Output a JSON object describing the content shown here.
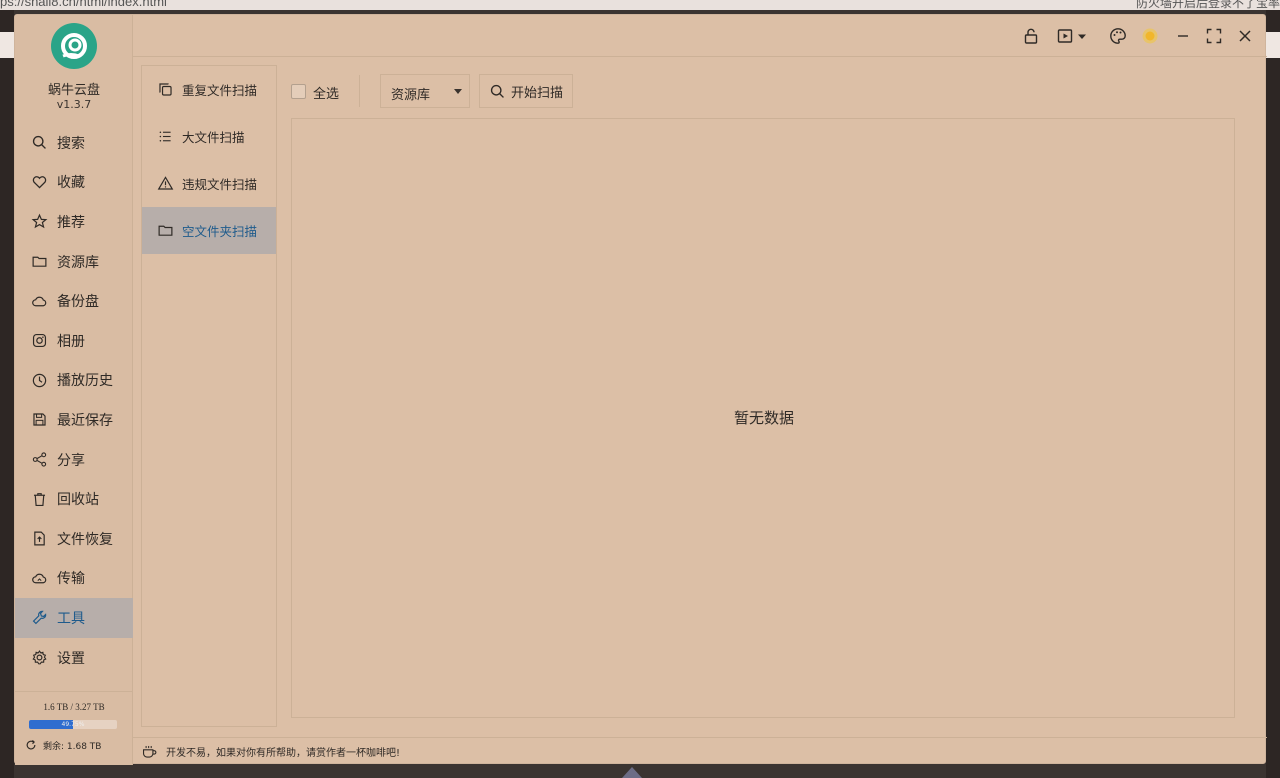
{
  "browser": {
    "url_fragment": "ps://snail8.cn/html/index.html",
    "right_text": "防火墙开启后登录不了宝率"
  },
  "app": {
    "name": "蜗牛云盘",
    "version": "v1.3.7"
  },
  "sidebar": {
    "items": [
      {
        "label": "搜索",
        "icon": "search-icon"
      },
      {
        "label": "收藏",
        "icon": "heart-icon"
      },
      {
        "label": "推荐",
        "icon": "star-icon"
      },
      {
        "label": "资源库",
        "icon": "folder-icon"
      },
      {
        "label": "备份盘",
        "icon": "cloud-icon"
      },
      {
        "label": "相册",
        "icon": "camera-icon"
      },
      {
        "label": "播放历史",
        "icon": "clock-icon"
      },
      {
        "label": "最近保存",
        "icon": "save-icon"
      },
      {
        "label": "分享",
        "icon": "share-icon"
      },
      {
        "label": "回收站",
        "icon": "trash-icon"
      },
      {
        "label": "文件恢复",
        "icon": "file-restore-icon"
      },
      {
        "label": "传输",
        "icon": "transfer-icon"
      },
      {
        "label": "工具",
        "icon": "wrench-icon",
        "active": true
      },
      {
        "label": "设置",
        "icon": "gear-icon"
      }
    ]
  },
  "storage": {
    "usage": "1.6 TB / 3.27 TB",
    "percent_label": "49.75%",
    "percent": 49.75,
    "remaining": "剩余: 1.68 TB"
  },
  "tools": {
    "items": [
      {
        "label": "重复文件扫描",
        "icon": "duplicate-icon"
      },
      {
        "label": "大文件扫描",
        "icon": "list-icon"
      },
      {
        "label": "违规文件扫描",
        "icon": "warning-icon"
      },
      {
        "label": "空文件夹扫描",
        "icon": "folder-icon",
        "active": true
      }
    ]
  },
  "toolbar": {
    "select_all_label": "全选",
    "library_select_value": "资源库",
    "scan_button_label": "开始扫描"
  },
  "results": {
    "empty_text": "暂无数据"
  },
  "footer": {
    "text": "开发不易，如果对你有所帮助，请赏作者一杯咖啡吧!"
  },
  "colors": {
    "background": "#dcbfa6",
    "active_item": "#b7aeaa",
    "active_text": "#1e5b8c",
    "logo": "#2aa488",
    "storage_fill": "#2f6dcf"
  }
}
